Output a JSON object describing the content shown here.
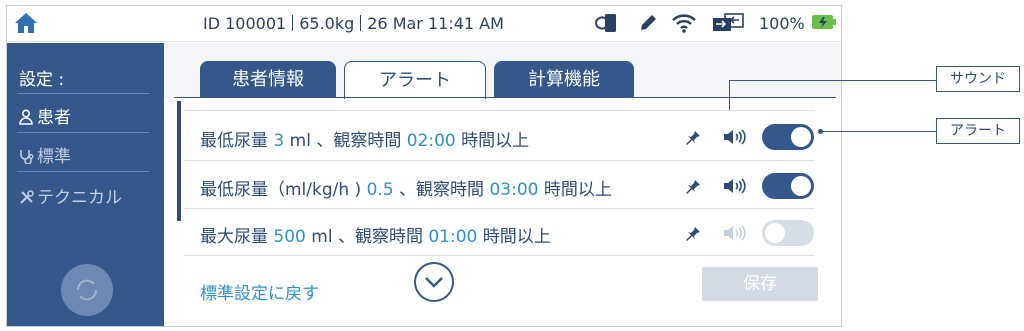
{
  "status_bar": {
    "patient_id": "ID 100001",
    "weight": "65.0kg",
    "datetime": "26 Mar  11:41 AM",
    "battery": "100%",
    "icons": [
      "home-icon",
      "sync-icon",
      "pen-icon",
      "wifi-icon",
      "transfer-icon",
      "battery-icon"
    ]
  },
  "sidebar": {
    "title": "設定 :",
    "items": [
      {
        "label": "患者",
        "icon": "person-icon"
      },
      {
        "label": "標準",
        "icon": "stethoscope-icon"
      },
      {
        "label": "テクニカル",
        "icon": "tools-icon"
      }
    ]
  },
  "tabs": [
    "患者情報",
    "アラート",
    "計算機能"
  ],
  "active_tab": "アラート",
  "alerts": [
    {
      "pre": "最低尿量 ",
      "value": "3",
      "unit": " ml 、観察時間 ",
      "time": "02:00",
      "post": " 時間以上",
      "sound": true,
      "enabled": true
    },
    {
      "pre": "最低尿量（ml/kg/h ) ",
      "value": "0.5",
      "unit": " 、観察時間 ",
      "time": "03:00",
      "post": " 時間以上",
      "sound": true,
      "enabled": true
    },
    {
      "pre": "最大尿量 ",
      "value": "500",
      "unit": " ml 、観察時間 ",
      "time": "01:00",
      "post": " 時間以上",
      "sound": false,
      "enabled": false
    }
  ],
  "reset_label": "標準設定に戻す",
  "save_label": "保存",
  "callouts": {
    "sound": "サウンド",
    "alert": "アラート"
  },
  "colors": {
    "primary": "#35578b",
    "accent": "#2f8fcf",
    "disabled": "#d4dae3"
  }
}
